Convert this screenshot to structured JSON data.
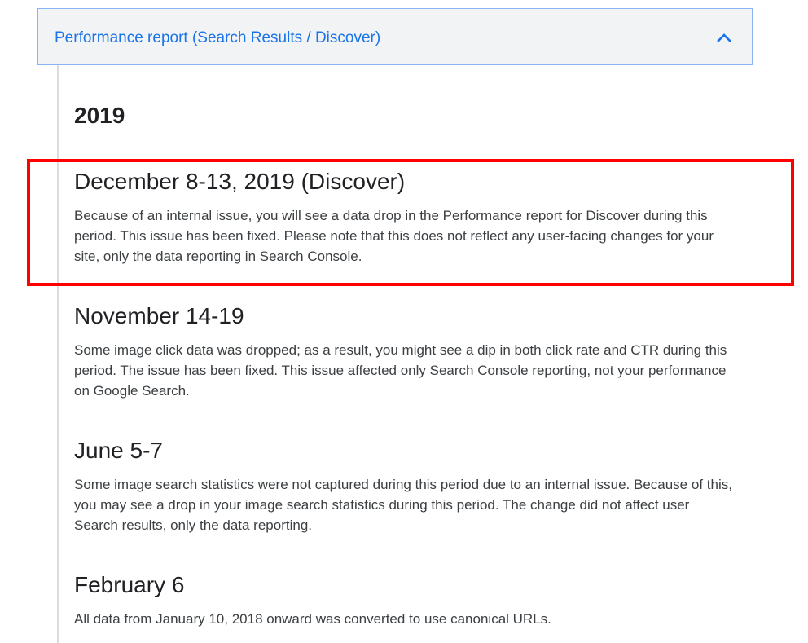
{
  "accordion": {
    "title": "Performance report (Search Results / Discover)",
    "chevron_icon": "chevron-up-icon",
    "accent_color": "#1a73e8"
  },
  "year": "2019",
  "entries": [
    {
      "title": "December 8-13, 2019 (Discover)",
      "body": "Because of an internal issue, you will see a data drop in the Performance report for Discover during this period. This issue has been fixed. Please note that this does not reflect any user-facing changes for your site, only the data reporting in Search Console."
    },
    {
      "title": "November 14-19",
      "body": "Some image click data was dropped; as a result, you might see a dip in both click rate and CTR during this period. The issue has been fixed. This issue affected only Search Console reporting, not your performance on Google Search."
    },
    {
      "title": "June 5-7",
      "body": "Some image search statistics were not captured during this period due to an internal issue. Because of this, you may see a drop in your image search statistics during this period. The change did not affect user Search results, only the data reporting."
    },
    {
      "title": "February 6",
      "body": "All data from January 10, 2018 onward was converted to use canonical URLs."
    }
  ],
  "highlight_color": "#ff0000"
}
